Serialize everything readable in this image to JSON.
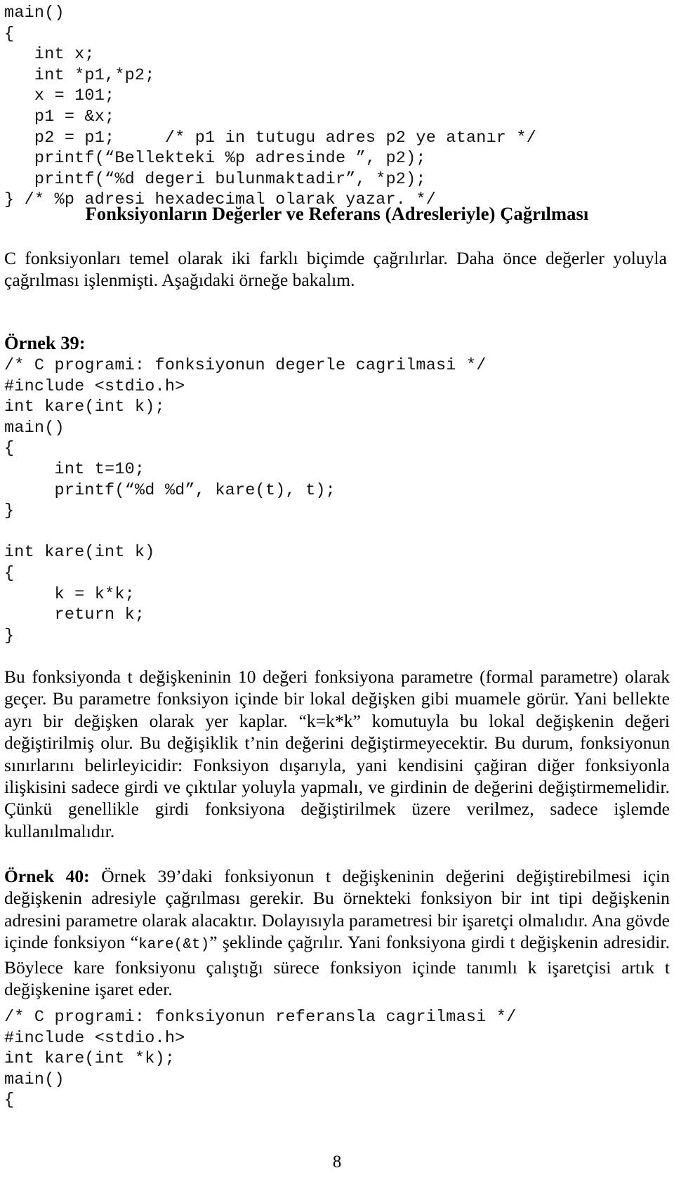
{
  "document": {
    "language": "tr",
    "page_number": "8"
  },
  "code_blocks": {
    "pointers_example": "main()\n{\n   int x;\n   int *p1,*p2;\n   x = 101;\n   p1 = &x;\n   p2 = p1;     /* p1 in tutugu adres p2 ye atanır */\n   printf(“Bellekteki %p adresinde ”, p2);\n   printf(“%d degeri bulunmaktadir”, *p2);\n} /* %p adresi hexadecimal olarak yazar. */",
    "kare_by_value": "/* C programi: fonksiyonun degerle cagrilmasi */\n#include <stdio.h>\nint kare(int k);\nmain()\n{\n     int t=10;\n     printf(“%d %d”, kare(t), t);\n}\n\nint kare(int k)\n{\n     k = k*k;\n     return k;\n}",
    "kare_by_reference": "/* C programi: fonksiyonun referansla cagrilmasi */\n#include <stdio.h>\nint kare(int *k);\nmain()\n{"
  },
  "headings": {
    "section_title": "Fonksiyonların Değerler ve Referans (Adresleriyle) Çağrılması",
    "example_39_label": "Örnek 39:"
  },
  "paragraphs": {
    "intro": "C fonksiyonları temel olarak iki farklı biçimde çağrılırlar. Daha önce değerler yoluyla çağrılması işlenmişti. Aşağıdaki örneğe bakalım.",
    "explanation": "Bu fonksiyonda t değişkeninin 10 değeri fonksiyona parametre (formal parametre) olarak geçer. Bu parametre fonksiyon içinde bir lokal değişken gibi muamele görür. Yani bellekte ayrı bir değişken olarak yer kaplar. “k=k*k” komutuyla bu lokal değişkenin değeri değiştirilmiş olur. Bu değişiklik t’nin değerini değiştirmeyecektir. Bu durum, fonksiyonun sınırlarını belirleyicidir: Fonksiyon dışarıyla, yani kendisini çağiran diğer fonksiyonla ilişkisini sadece girdi ve çıktılar yoluyla yapmalı, ve girdinin de değerini değiştirmemelidir. Çünkü genellikle girdi fonksiyona değiştirilmek üzere verilmez, sadece işlemde kullanılmalıdır.",
    "example_40": {
      "label": "Örnek 40:",
      "part_1": " Örnek 39’daki fonksiyonun t değişkeninin değerini değiştirebilmesi için değişkenin adresiyle çağrılması gerekir. Bu örnekteki fonksiyon bir int tipi değişkenin adresini parametre olarak alacaktır. Dolayısıyla parametresi bir işaretçi olmalıdır. Ana gövde içinde fonksiyon “",
      "inline_code": "kare(&t)",
      "part_2": "” şeklinde çağrılır. Yani fonksiyona girdi t değişkenin adresidir. Böylece kare fonksiyonu çalıştığı sürece fonksiyon içinde tanımlı k işaretçisi artık t değişkenine işaret eder."
    }
  }
}
